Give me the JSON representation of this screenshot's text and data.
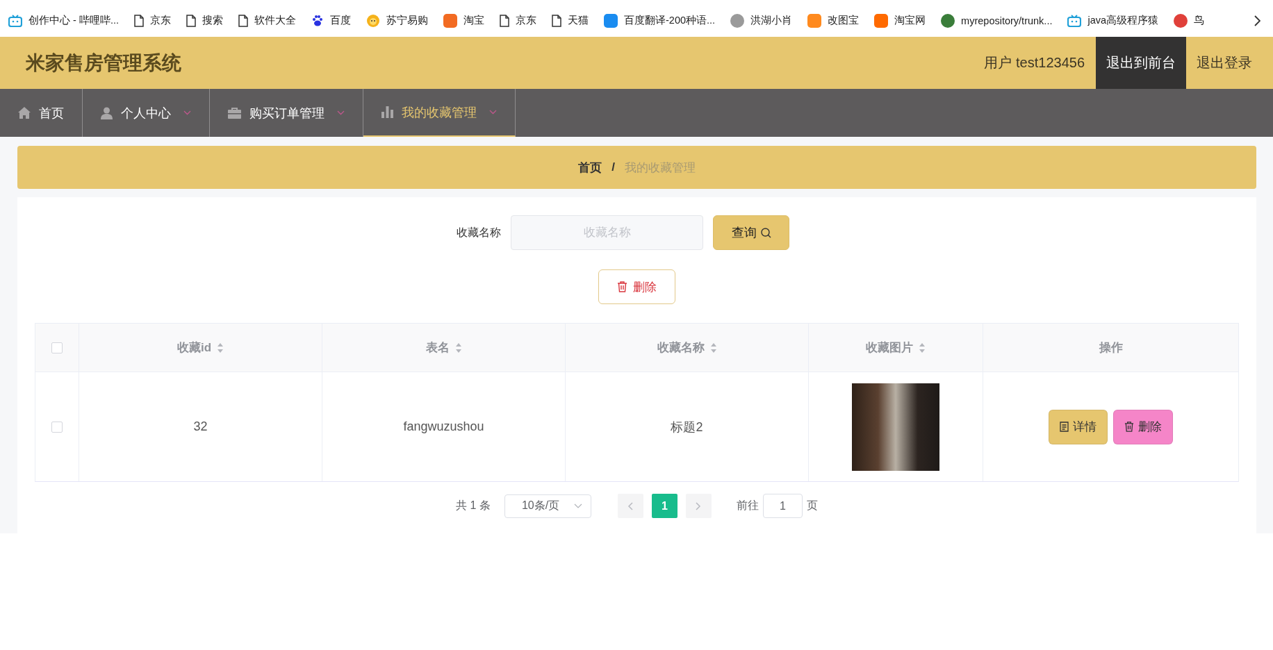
{
  "bookmarks": [
    {
      "kind": "tv",
      "label": "创作中心 - 哔哩哔..."
    },
    {
      "kind": "page",
      "label": "京东"
    },
    {
      "kind": "page",
      "label": "搜索"
    },
    {
      "kind": "page",
      "label": "软件大全"
    },
    {
      "kind": "paw",
      "label": "百度"
    },
    {
      "kind": "sun",
      "label": "苏宁易购"
    },
    {
      "kind": "square",
      "color": "#f26b22",
      "label": "淘宝"
    },
    {
      "kind": "page",
      "label": "京东"
    },
    {
      "kind": "page",
      "label": "天猫"
    },
    {
      "kind": "square",
      "color": "#1a8cf0",
      "label": "百度翻译-200种语..."
    },
    {
      "kind": "circle",
      "color": "#9a9a9a",
      "label": "洪湖小肖"
    },
    {
      "kind": "square",
      "color": "#ff8a1e",
      "label": "改图宝"
    },
    {
      "kind": "square",
      "color": "#ff6a00",
      "label": "淘宝网"
    },
    {
      "kind": "circle",
      "color": "#3a7d3a",
      "label": "myrepository/trunk..."
    },
    {
      "kind": "tv",
      "label": "java高级程序猿"
    },
    {
      "kind": "circle",
      "color": "#e0403a",
      "label": "鸟"
    }
  ],
  "header": {
    "title": "米家售房管理系统",
    "user": "用户 test123456",
    "buttons": [
      {
        "label": "退出到前台",
        "selected": true
      },
      {
        "label": "退出登录",
        "selected": false
      }
    ]
  },
  "nav": [
    {
      "kind": "home",
      "label": "首页",
      "dropdown": false,
      "selected": false
    },
    {
      "kind": "user",
      "label": "个人中心",
      "dropdown": true,
      "selected": false
    },
    {
      "kind": "briefcase",
      "label": "购买订单管理",
      "dropdown": true,
      "selected": false
    },
    {
      "kind": "chart",
      "label": "我的收藏管理",
      "dropdown": true,
      "selected": true
    }
  ],
  "breadcrumb": {
    "items": [
      "首页",
      "我的收藏管理"
    ],
    "separator": "/"
  },
  "search": {
    "label": "收藏名称",
    "placeholder": "收藏名称",
    "button": "查询"
  },
  "delete_button": "删除",
  "table": {
    "columns": [
      {
        "label": "收藏id",
        "sortable": true
      },
      {
        "label": "表名",
        "sortable": true
      },
      {
        "label": "收藏名称",
        "sortable": true
      },
      {
        "label": "收藏图片",
        "sortable": true
      },
      {
        "label": "操作",
        "sortable": false
      }
    ],
    "header_checked": false,
    "rows": [
      {
        "checked": false,
        "cells": [
          "32",
          "fangwuzushou",
          "标题2"
        ],
        "actions": [
          {
            "kind": "detail",
            "label": "详情"
          },
          {
            "kind": "delete",
            "label": "删除"
          }
        ]
      }
    ]
  },
  "pagination": {
    "total": "共 1 条",
    "page_size": "10条/页",
    "pages": [
      {
        "label": "1",
        "selected": true
      }
    ],
    "goto_label": "前往",
    "goto_value": "1",
    "goto_suffix": "页"
  }
}
